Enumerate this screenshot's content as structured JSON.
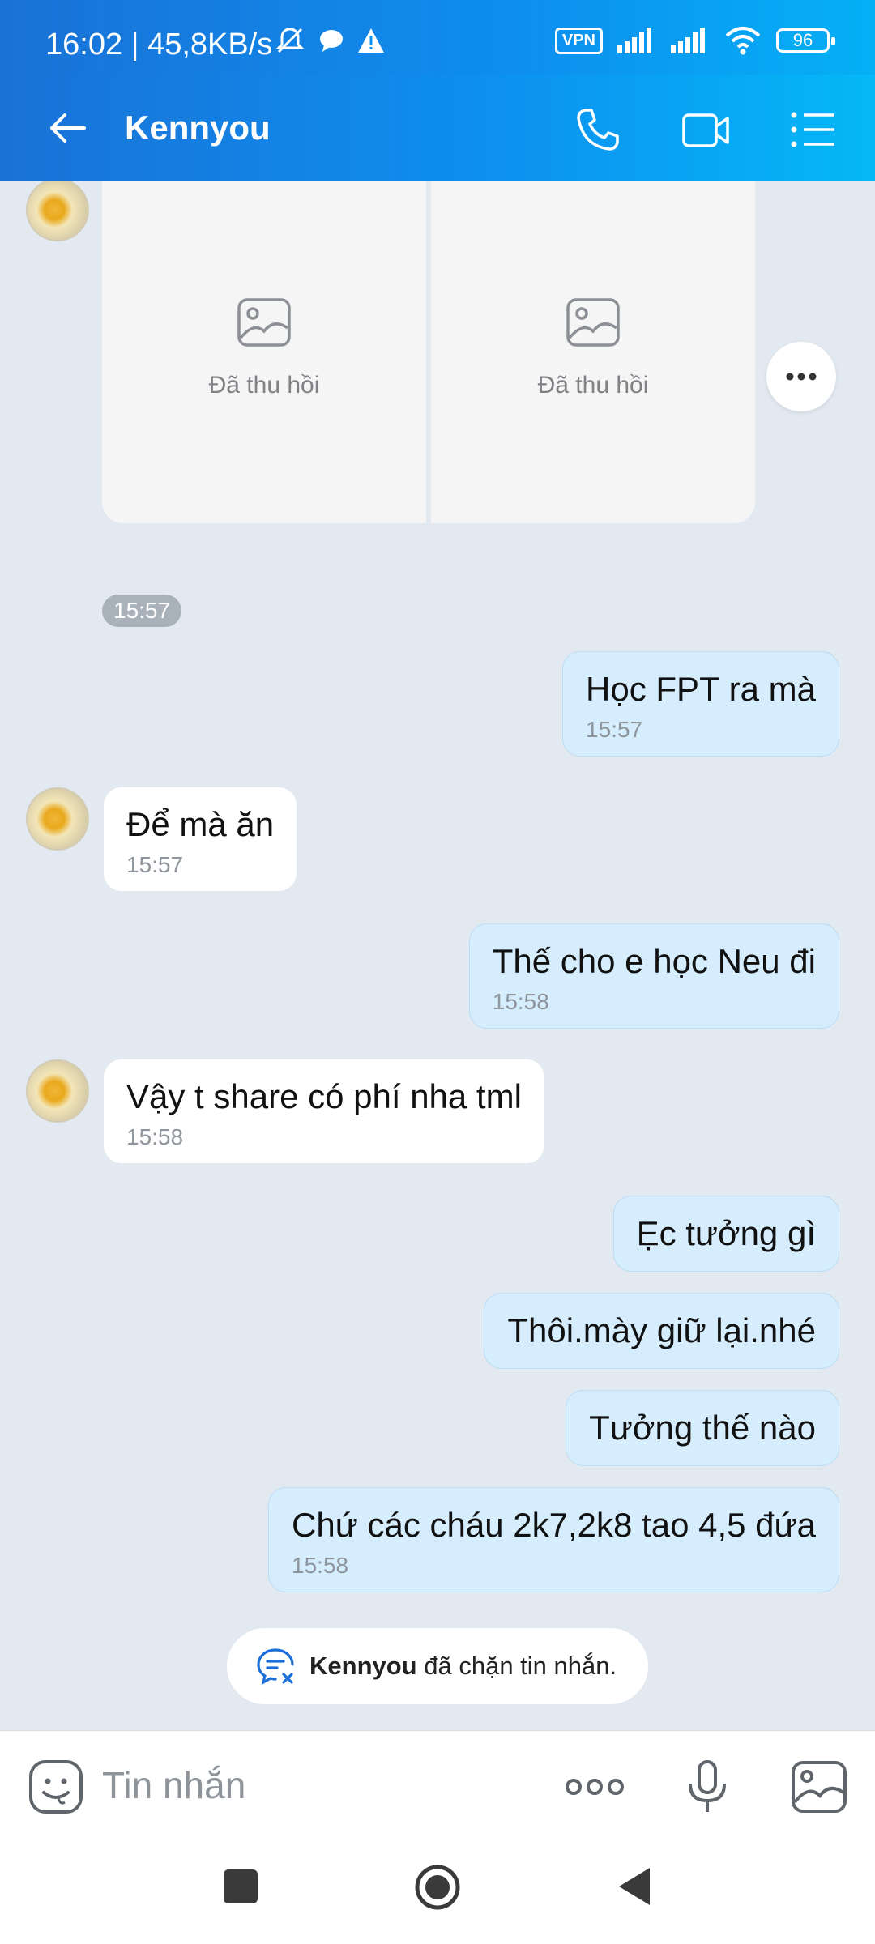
{
  "status": {
    "time": "16:02 | 45,8KB/s",
    "vpn": "VPN",
    "battery": "96"
  },
  "header": {
    "title": "Kennyou"
  },
  "recalled": [
    {
      "label": "Đã thu hồi"
    },
    {
      "label": "Đã thu hồi"
    }
  ],
  "recalled_time": "15:57",
  "messages": [
    {
      "dir": "out",
      "text": "Học FPT ra mà",
      "time": "15:57"
    },
    {
      "dir": "in",
      "text": "Để mà ăn",
      "time": "15:57"
    },
    {
      "dir": "out",
      "text": "Thế cho e học Neu đi",
      "time": "15:58"
    },
    {
      "dir": "in",
      "text": "Vậy t share có phí nha tml",
      "time": "15:58"
    },
    {
      "dir": "out",
      "text": "Ẹc tưởng gì",
      "time": ""
    },
    {
      "dir": "out",
      "text": "Thôi.mày giữ lại.nhé",
      "time": ""
    },
    {
      "dir": "out",
      "text": "Tưởng thế nào",
      "time": ""
    },
    {
      "dir": "out",
      "text": "Chứ các cháu 2k7,2k8 tao 4,5 đứa",
      "time": "15:58"
    }
  ],
  "blocked_notice": {
    "name": "Kennyou",
    "text": "đã chặn tin nhắn."
  },
  "input": {
    "placeholder": "Tin nhắn"
  }
}
